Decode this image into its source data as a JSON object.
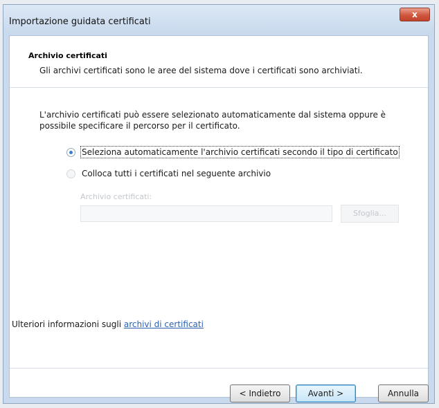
{
  "window": {
    "title": "Importazione guidata certificati",
    "close_label": "x"
  },
  "header": {
    "title": "Archivio certificati",
    "description": "Gli archivi certificati sono le aree del sistema dove i certificati sono archiviati."
  },
  "intro_text": "L'archivio certificati può essere selezionato automaticamente dal sistema oppure è possibile specificare il percorso per il certificato.",
  "options": {
    "auto": {
      "label": "Seleziona automaticamente l'archivio certificati secondo il tipo di certificato",
      "selected": true
    },
    "manual": {
      "label": "Colloca tutti i certificati nel seguente archivio",
      "selected": false
    }
  },
  "store": {
    "label": "Archivio certificati:",
    "value": "",
    "browse_label": "Sfoglia..."
  },
  "info": {
    "prefix": "Ulteriori informazioni sugli ",
    "link": "archivi di certificati"
  },
  "buttons": {
    "back": "< Indietro",
    "next": "Avanti >",
    "cancel": "Annulla"
  },
  "colors": {
    "accent": "#3f7ad0",
    "link": "#2a61b3",
    "close_red": "#c1432c"
  }
}
